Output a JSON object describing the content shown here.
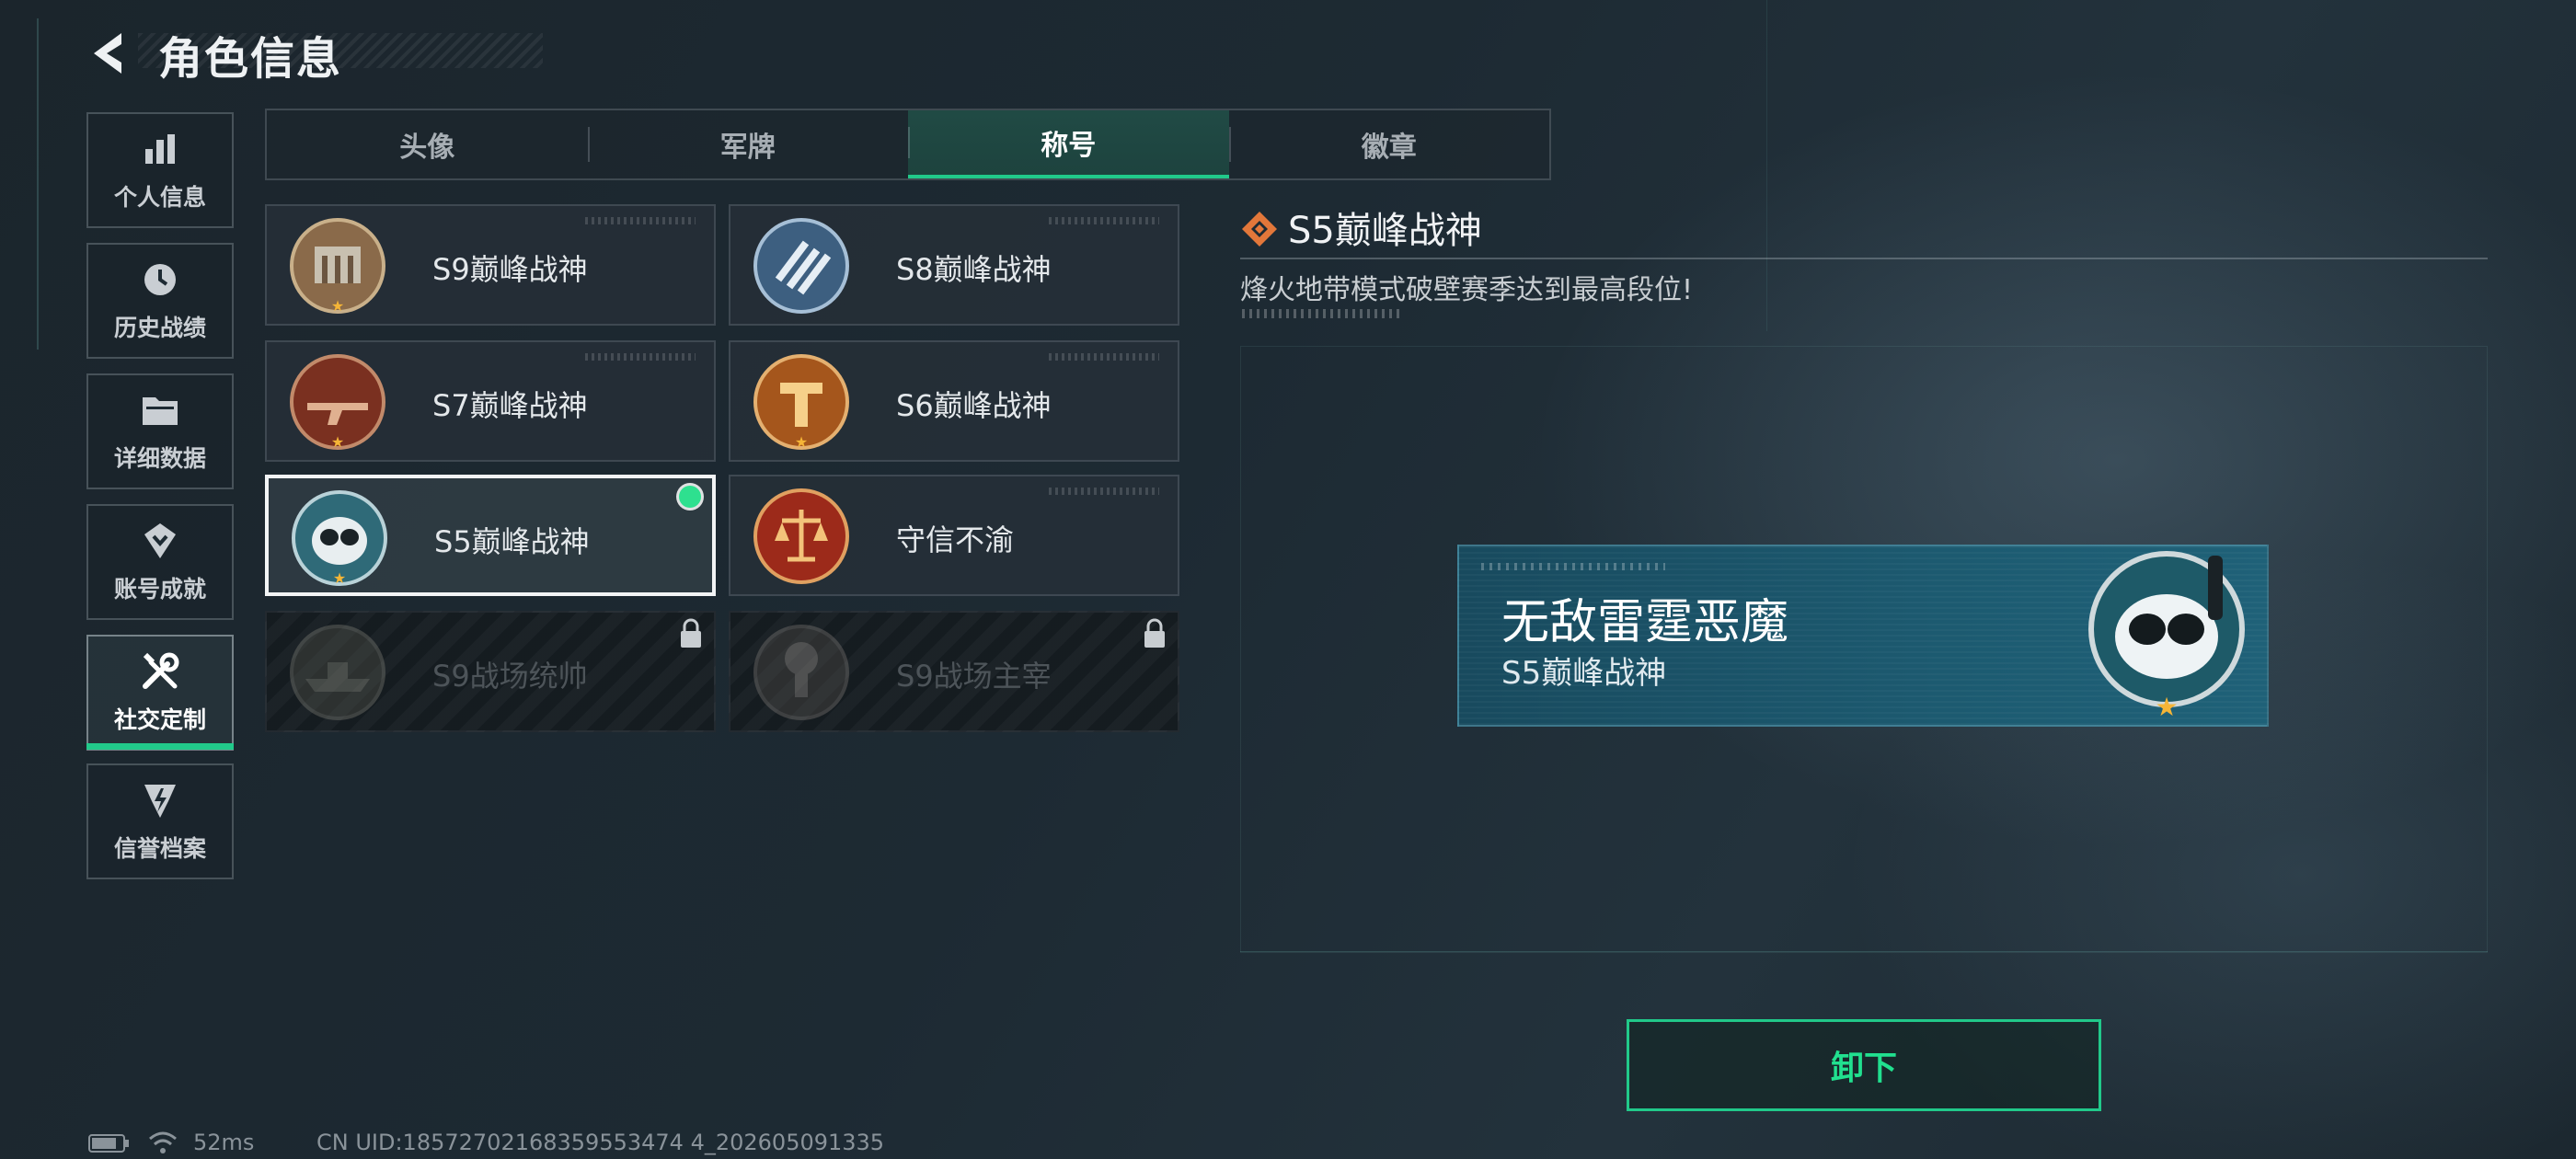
{
  "header": {
    "title": "角色信息"
  },
  "sidebar": {
    "items": [
      {
        "label": "个人信息",
        "icon": "bar-chart-icon"
      },
      {
        "label": "历史战绩",
        "icon": "history-icon"
      },
      {
        "label": "详细数据",
        "icon": "folder-icon"
      },
      {
        "label": "账号成就",
        "icon": "achievement-icon"
      },
      {
        "label": "社交定制",
        "icon": "tools-icon"
      },
      {
        "label": "信誉档案",
        "icon": "reputation-icon"
      }
    ],
    "active_index": 4
  },
  "tabs": [
    {
      "label": "头像"
    },
    {
      "label": "军牌"
    },
    {
      "label": "称号"
    },
    {
      "label": "徽章"
    }
  ],
  "active_tab": 2,
  "titles": [
    {
      "name": "S9巅峰战神",
      "state": "normal",
      "badge_color": "#8a6a4a"
    },
    {
      "name": "S8巅峰战神",
      "state": "normal",
      "badge_color": "#3d5f80"
    },
    {
      "name": "S7巅峰战神",
      "state": "normal",
      "badge_color": "#7a3020"
    },
    {
      "name": "S6巅峰战神",
      "state": "normal",
      "badge_color": "#a5561c"
    },
    {
      "name": "S5巅峰战神",
      "state": "selected",
      "badge_color": "#2f6a78"
    },
    {
      "name": "守信不渝",
      "state": "normal",
      "badge_color": "#9c2a1a"
    },
    {
      "name": "S9战场统帅",
      "state": "locked",
      "badge_color": "#5a5a50"
    },
    {
      "name": "S9战场主宰",
      "state": "locked",
      "badge_color": "#5a5450"
    }
  ],
  "detail": {
    "name": "S5巅峰战神",
    "description": "烽火地带模式破壁赛季达到最高段位!"
  },
  "preview": {
    "player_name": "无敌雷霆恶魔",
    "title": "S5巅峰战神"
  },
  "actions": {
    "unequip_label": "卸下"
  },
  "status_bar": {
    "ping": "52ms",
    "uid": "CN UID:18572702168359553474 4_202605091335"
  },
  "colors": {
    "accent": "#21c98a",
    "selected_border": "#f2f4f5"
  }
}
